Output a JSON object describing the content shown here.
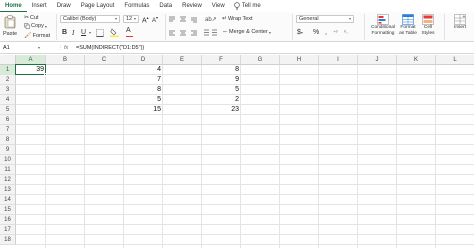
{
  "ribbon_tabs": [
    "Home",
    "Insert",
    "Draw",
    "Page Layout",
    "Formulas",
    "Data",
    "Review",
    "View",
    "Tell me"
  ],
  "clipboard": {
    "paste": "Paste",
    "cut": "Cut",
    "copy": "Copy",
    "format": "Format"
  },
  "font": {
    "name": "Calibri (Body)",
    "size": "12",
    "bold": "B",
    "italic": "I",
    "underline": "U"
  },
  "alignment": {
    "wrap": "Wrap Text",
    "merge": "Merge & Center"
  },
  "number": {
    "format": "General",
    "currency": "$",
    "percent": "%",
    "comma": ","
  },
  "styles": {
    "conditional": [
      "Conditional",
      "Formatting"
    ],
    "format_table": [
      "Format",
      "as Table"
    ],
    "cell_styles": [
      "Cell",
      "Styles"
    ]
  },
  "cells_group": {
    "insert": "Insert"
  },
  "formula_bar": {
    "name_box": "A1",
    "fx": "fx",
    "formula": "=SUM(INDIRECT(\"D1:D5\"))"
  },
  "columns": [
    "A",
    "B",
    "C",
    "D",
    "E",
    "F",
    "G",
    "H",
    "I",
    "J",
    "K",
    "L"
  ],
  "rows": [
    "1",
    "2",
    "3",
    "4",
    "5",
    "6",
    "7",
    "8",
    "9",
    "10",
    "11",
    "12",
    "13",
    "14",
    "15",
    "16",
    "17",
    "18"
  ],
  "cells": {
    "A1": "39",
    "D1": "4",
    "D2": "7",
    "D3": "8",
    "D4": "5",
    "D5": "15",
    "F1": "8",
    "F2": "9",
    "F3": "5",
    "F4": "2",
    "F5": "23"
  },
  "colors": {
    "accent": "#1e7145"
  }
}
